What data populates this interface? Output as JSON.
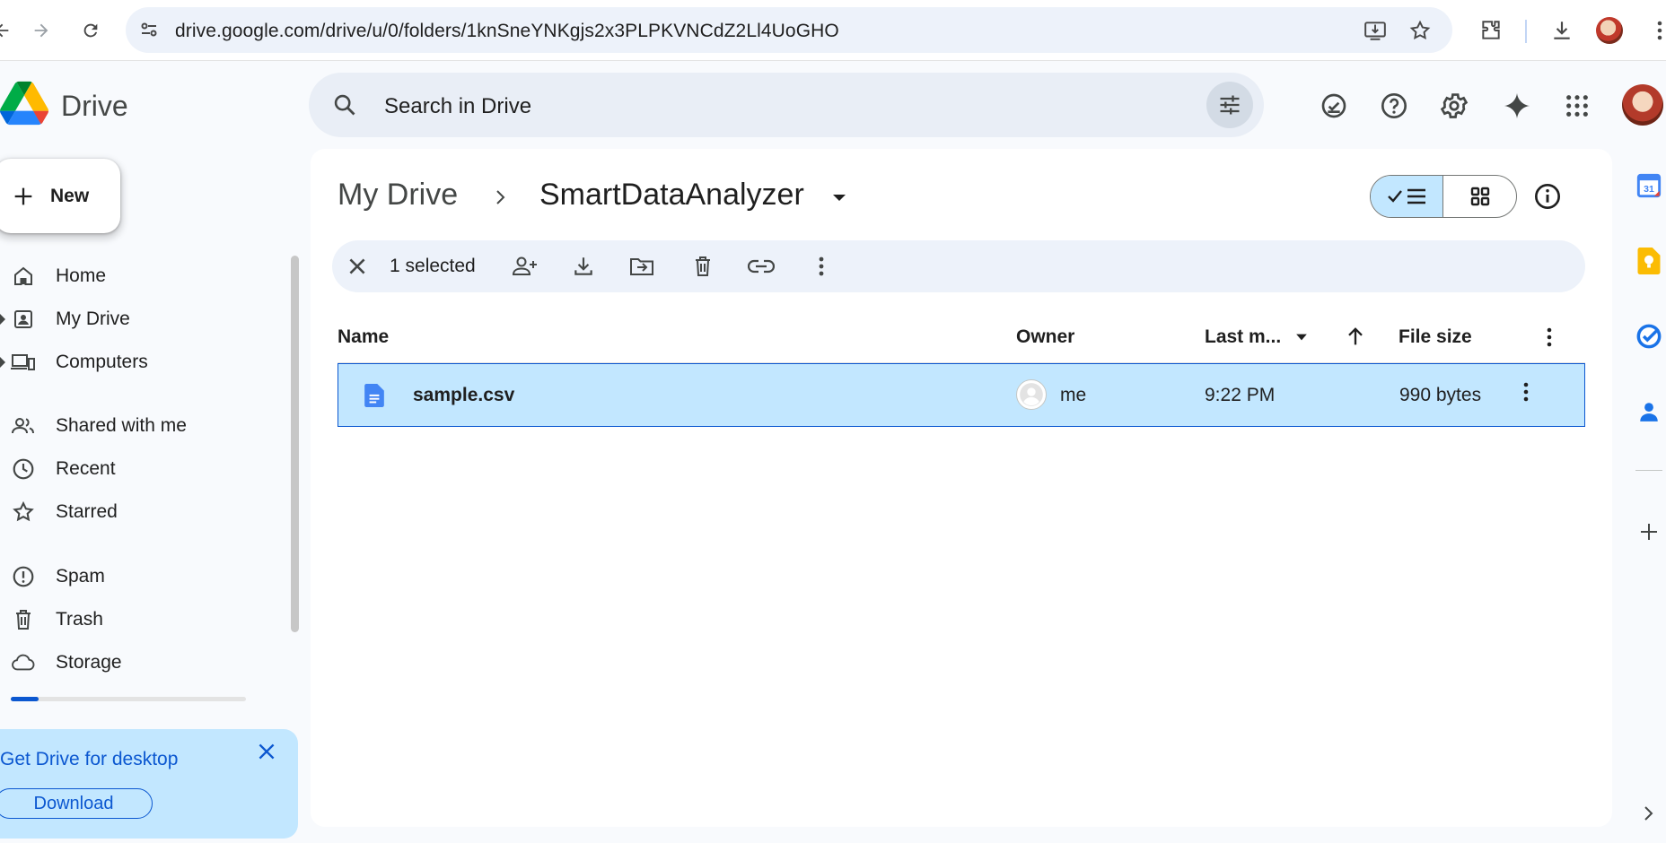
{
  "browser": {
    "url": "drive.google.com/drive/u/0/folders/1knSneYNKgjs2x3PLPKVNCdZ2Ll4UoGHO"
  },
  "app": {
    "logo_text": "Drive"
  },
  "search": {
    "placeholder": "Search in Drive"
  },
  "sidebar": {
    "new_label": "New",
    "items": [
      {
        "label": "Home",
        "icon": "home-icon"
      },
      {
        "label": "My Drive",
        "icon": "my-drive-icon"
      },
      {
        "label": "Computers",
        "icon": "computers-icon"
      },
      {
        "label": "Shared with me",
        "icon": "shared-icon"
      },
      {
        "label": "Recent",
        "icon": "clock-icon"
      },
      {
        "label": "Starred",
        "icon": "star-icon"
      },
      {
        "label": "Spam",
        "icon": "spam-icon"
      },
      {
        "label": "Trash",
        "icon": "trash-icon"
      },
      {
        "label": "Storage",
        "icon": "cloud-icon"
      }
    ],
    "storage_used_fraction": 0.12,
    "promo": {
      "title": "Get Drive for desktop",
      "button": "Download"
    }
  },
  "breadcrumb": {
    "root": "My Drive",
    "current": "SmartDataAnalyzer"
  },
  "selection": {
    "count_label": "1 selected"
  },
  "table": {
    "columns": {
      "name": "Name",
      "owner": "Owner",
      "modified": "Last m...",
      "size": "File size"
    },
    "rows": [
      {
        "name": "sample.csv",
        "owner": "me",
        "modified": "9:22 PM",
        "size": "990 bytes",
        "selected": true
      }
    ]
  },
  "colors": {
    "accent": "#0b57d0",
    "selected_bg": "#c2e7ff",
    "page_bg": "#f8fafd"
  }
}
